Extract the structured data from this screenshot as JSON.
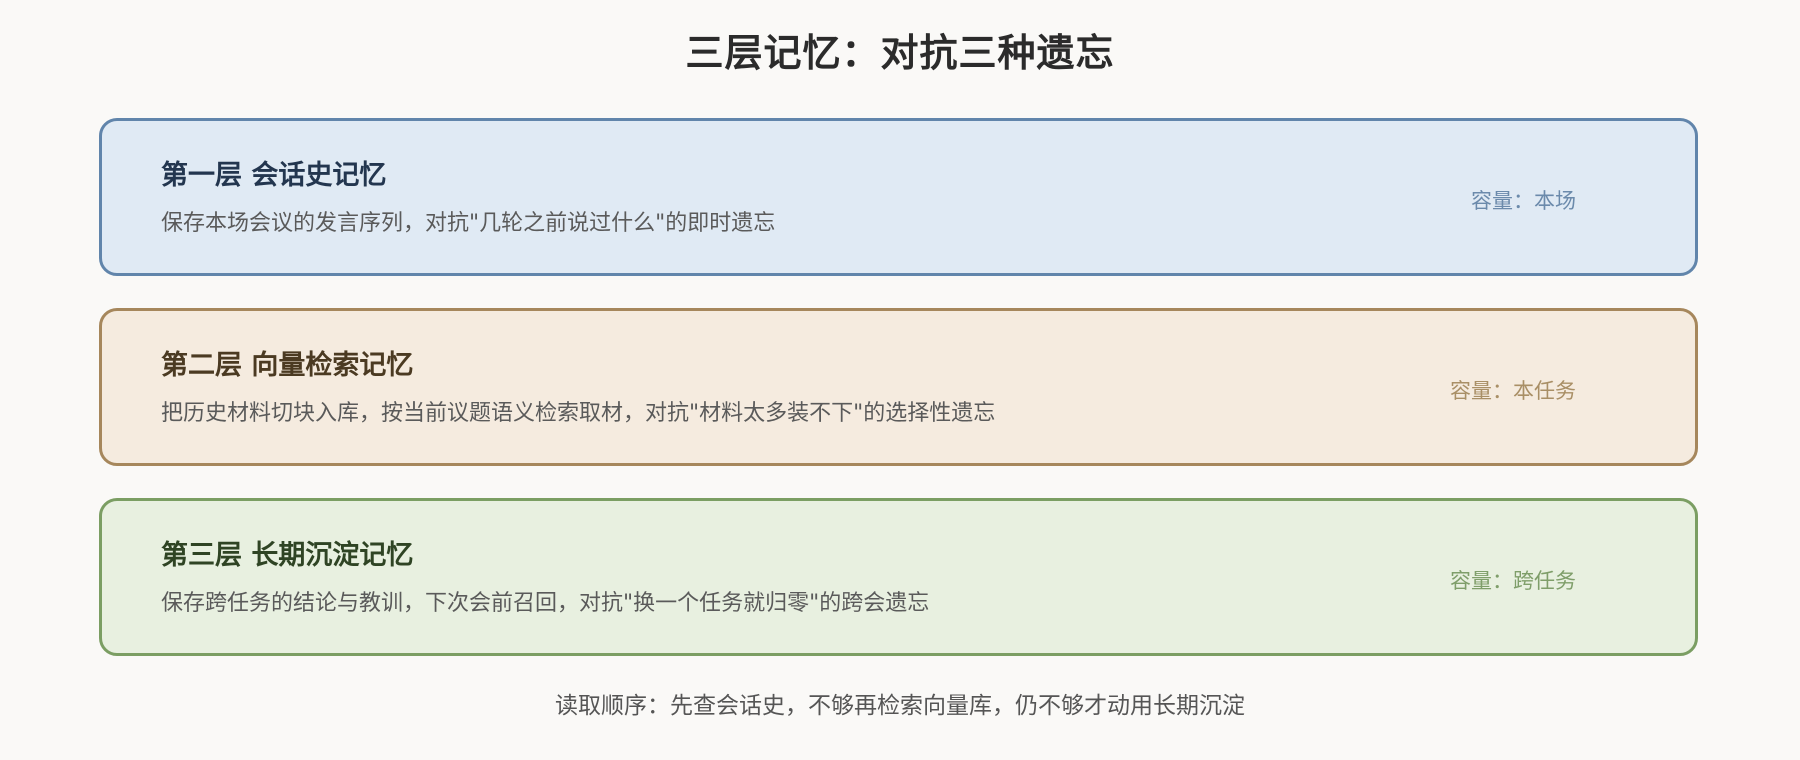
{
  "title": "三层记忆：对抗三种遗忘",
  "layers": [
    {
      "title": "第一层 会话史记忆",
      "description": "保存本场会议的发言序列，对抗\"几轮之前说过什么\"的即时遗忘",
      "capacity": "容量：本场",
      "colors": {
        "background": "#e0eaf4",
        "border": "#6185ab",
        "title": "#23364f",
        "capacity": "#6b8aab"
      }
    },
    {
      "title": "第二层 向量检索记忆",
      "description": "把历史材料切块入库，按当前议题语义检索取材，对抗\"材料太多装不下\"的选择性遗忘",
      "capacity": "容量：本任务",
      "colors": {
        "background": "#f5ebdf",
        "border": "#a6875c",
        "title": "#4b3a22",
        "capacity": "#a98f66"
      }
    },
    {
      "title": "第三层 长期沉淀记忆",
      "description": "保存跨任务的结论与教训，下次会前召回，对抗\"换一个任务就归零\"的跨会遗忘",
      "capacity": "容量：跨任务",
      "colors": {
        "background": "#e8f0e0",
        "border": "#7b9e63",
        "title": "#2f4424",
        "capacity": "#7f9e6a"
      }
    }
  ],
  "footer": "读取顺序：先查会话史，不够再检索向量库，仍不够才动用长期沉淀"
}
